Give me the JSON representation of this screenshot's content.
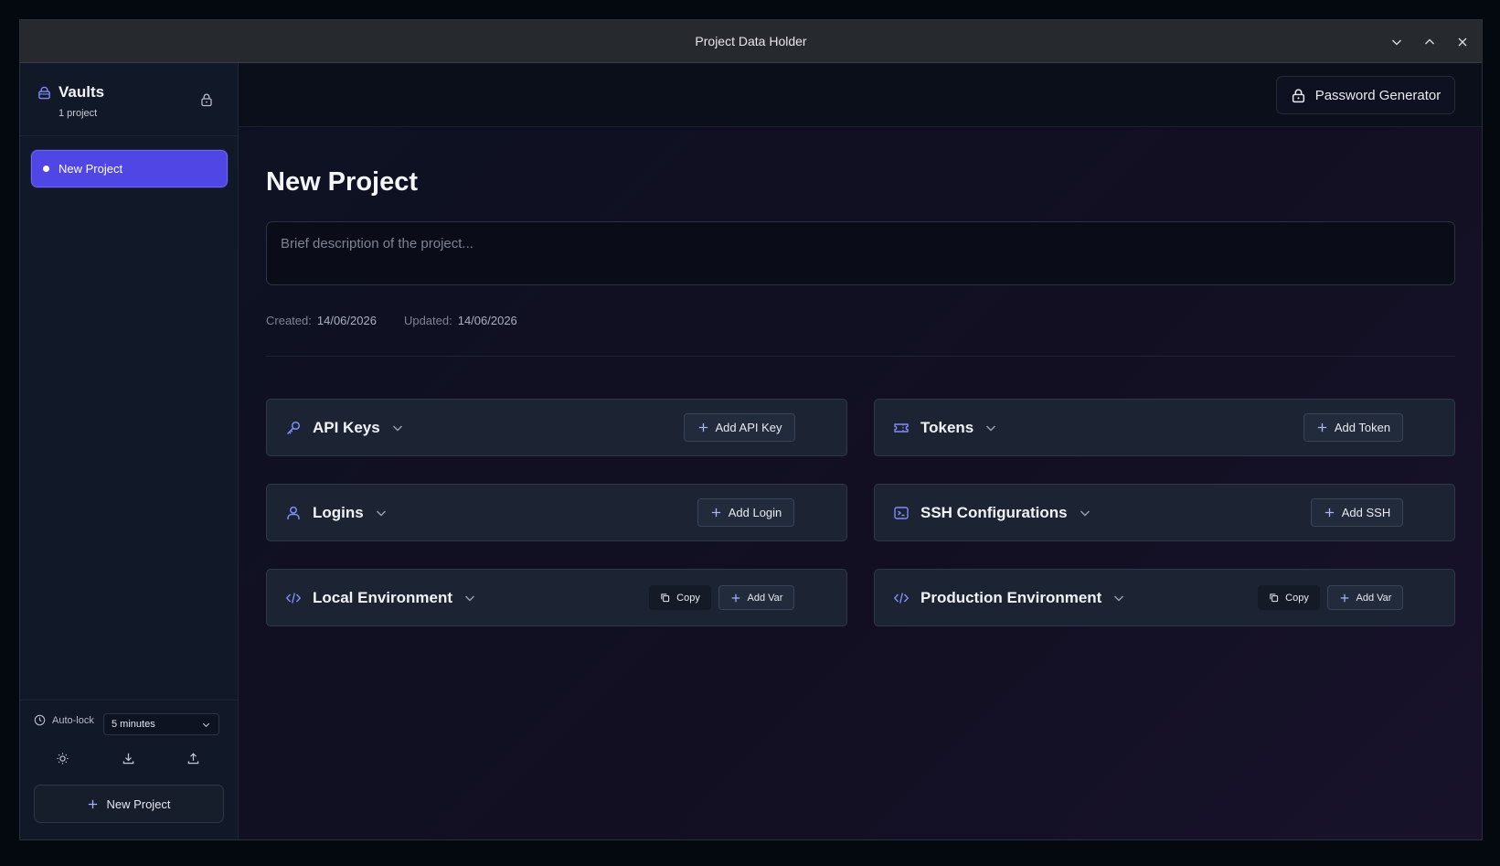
{
  "window": {
    "title": "Project Data Holder"
  },
  "sidebar": {
    "brand": "Vaults",
    "project_count": "1 project",
    "projects": [
      {
        "label": "New Project",
        "active": true
      }
    ],
    "autolock_label": "Auto-lock",
    "autolock_value": "5 minutes",
    "new_project_label": "New Project"
  },
  "toolbar": {
    "password_generator_label": "Password Generator"
  },
  "project": {
    "title": "New Project",
    "description_placeholder": "Brief description of the project...",
    "created_label": "Created:",
    "created_value": "14/06/2026",
    "updated_label": "Updated:",
    "updated_value": "14/06/2026"
  },
  "sections": {
    "api_keys": {
      "title": "API Keys",
      "add_label": "Add API Key"
    },
    "tokens": {
      "title": "Tokens",
      "add_label": "Add Token"
    },
    "logins": {
      "title": "Logins",
      "add_label": "Add Login"
    },
    "ssh": {
      "title": "SSH Configurations",
      "add_label": "Add SSH"
    },
    "local_env": {
      "title": "Local Environment",
      "copy_label": "Copy",
      "add_label": "Add Var"
    },
    "prod_env": {
      "title": "Production Environment",
      "copy_label": "Copy",
      "add_label": "Add Var"
    }
  },
  "colors": {
    "accent": "#4f46e5",
    "icon_accent": "#818cf8"
  }
}
